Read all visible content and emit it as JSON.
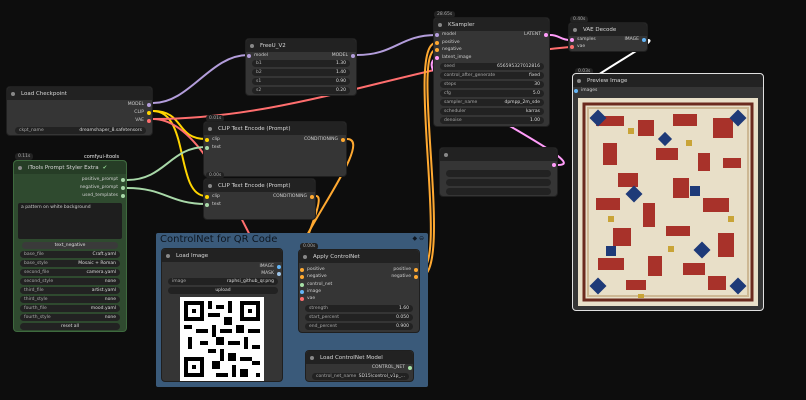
{
  "colors": {
    "model": "#b39ddb",
    "clip": "#ffd500",
    "vae": "#ff6e6e",
    "conditioning": "#ffa931",
    "latent": "#ff9cf9",
    "image": "#64b5f6",
    "control": "#a6e0a6",
    "string": "#a8d8a8",
    "group": "#3a5a7a"
  },
  "load_checkpoint": {
    "title": "Load Checkpoint",
    "out_model": "MODEL",
    "out_clip": "CLIP",
    "out_vae": "VAE",
    "ckpt_label": "ckpt_name",
    "ckpt_value": "dreamshaper_8.safetensors"
  },
  "freeu": {
    "title": "FreeU_V2",
    "in_model": "model",
    "out_model": "MODEL",
    "b1_label": "b1",
    "b1": "1.30",
    "b2_label": "b2",
    "b2": "1.40",
    "s1_label": "s1",
    "s1": "0.90",
    "s2_label": "s2",
    "s2": "0.20"
  },
  "ksampler": {
    "badge": "28.65s",
    "title": "KSampler",
    "in_model": "model",
    "in_positive": "positive",
    "in_negative": "negative",
    "in_latent": "latent_image",
    "out_latent": "LATENT",
    "widgets": [
      {
        "label": "seed",
        "value": "656595327012816"
      },
      {
        "label": "control_after_generate",
        "value": "fixed"
      },
      {
        "label": "steps",
        "value": "30"
      },
      {
        "label": "cfg",
        "value": "5.0"
      },
      {
        "label": "sampler_name",
        "value": "dpmpp_2m_sde"
      },
      {
        "label": "scheduler",
        "value": "karras"
      },
      {
        "label": "denoise",
        "value": "1.00"
      }
    ]
  },
  "vae_decode": {
    "badge": "0.40s",
    "title": "VAE Decode",
    "in_samples": "samples",
    "in_vae": "vae",
    "out_image": "IMAGE"
  },
  "preview": {
    "badge": "0.03s",
    "title": "Preview Image",
    "in_images": "images"
  },
  "clip1": {
    "badge": "0.01s",
    "title": "CLIP Text Encode (Prompt)",
    "in_clip": "clip",
    "in_text": "text",
    "out": "CONDITIONING"
  },
  "clip2": {
    "badge": "0.00s",
    "title": "CLIP Text Encode (Prompt)",
    "in_clip": "clip",
    "in_text": "text",
    "out": "CONDITIONING"
  },
  "styler": {
    "badge": "0.11s",
    "brand": "comfyui-itools",
    "title": "iTools Prompt Styler Extra",
    "out_pos": "positive_prompt",
    "out_neg": "negative_prompt",
    "out_used": "used_templates",
    "text": "a pattern on white background",
    "text_negative": "text_negative",
    "widgets": [
      {
        "label": "base_file",
        "value": "Craft.yaml"
      },
      {
        "label": "base_style",
        "value": "Mosaic + Roman"
      },
      {
        "label": "second_file",
        "value": "camera.yaml"
      },
      {
        "label": "second_style",
        "value": "none"
      },
      {
        "label": "third_file",
        "value": "artist.yaml"
      },
      {
        "label": "third_style",
        "value": "none"
      },
      {
        "label": "fourth_file",
        "value": "mood.yaml"
      },
      {
        "label": "fourth_style",
        "value": "none"
      }
    ],
    "reset": "reset all"
  },
  "group": {
    "title": "ControlNet for QR Code"
  },
  "load_image": {
    "title": "Load Image",
    "out_image": "IMAGE",
    "out_mask": "MASK",
    "image_label": "image",
    "image_value": "raphsi_github_qr.png",
    "upload": "upload"
  },
  "apply_cn": {
    "badge": "0.00s",
    "title": "Apply ControlNet",
    "in_positive": "positive",
    "in_negative": "negative",
    "in_cn": "control_net",
    "in_image": "image",
    "in_vae": "vae",
    "out_positive": "positive",
    "out_negative": "negative",
    "widgets": [
      {
        "label": "strength",
        "value": "1.60"
      },
      {
        "label": "start_percent",
        "value": "0.050"
      },
      {
        "label": "end_percent",
        "value": "0.900"
      }
    ]
  },
  "load_cn": {
    "title": "Load ControlNet Model",
    "out": "CONTROL_NET",
    "name_label": "control_net_name",
    "name_value": "SD15\\control_v1p_..."
  }
}
